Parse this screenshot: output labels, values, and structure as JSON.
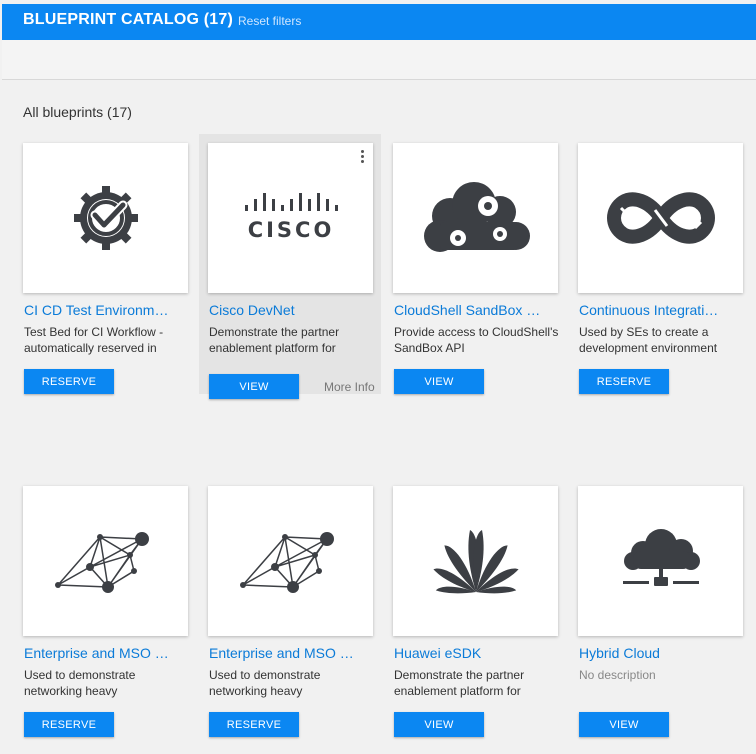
{
  "header": {
    "title": "BLUEPRINT CATALOG (17)",
    "reset_label": "Reset filters"
  },
  "section": {
    "title": "All blueprints (17)"
  },
  "cards": [
    {
      "name": "CI CD Test Environm…",
      "description": "Test Bed for CI Workflow - automatically reserved in",
      "action": "RESERVE",
      "icon": "gear-check-icon"
    },
    {
      "name": "Cisco DevNet",
      "description": "Demonstrate the partner enablement platform for",
      "action": "VIEW",
      "more_info": "More Info",
      "icon": "cisco-logo-icon"
    },
    {
      "name": "CloudShell SandBox …",
      "description": "Provide access to CloudShell's SandBox API",
      "action": "VIEW",
      "icon": "cloud-gears-icon"
    },
    {
      "name": "Continuous Integrati…",
      "description": "Used by SEs to create a development environment",
      "action": "RESERVE",
      "icon": "infinity-arrows-icon"
    },
    {
      "name": "Enterprise and MSO …",
      "description": "Used to demonstrate networking heavy",
      "action": "RESERVE",
      "icon": "network-graph-icon"
    },
    {
      "name": "Enterprise and MSO …",
      "description": "Used to demonstrate networking heavy",
      "action": "RESERVE",
      "icon": "network-graph-icon"
    },
    {
      "name": "Huawei eSDK",
      "description": "Demonstrate the partner enablement platform for",
      "action": "VIEW",
      "icon": "huawei-logo-icon"
    },
    {
      "name": "Hybrid Cloud",
      "description": "No description",
      "action": "VIEW",
      "icon": "cloud-network-icon"
    }
  ],
  "colors": {
    "accent": "#0b87f2",
    "link": "#0b7bd8",
    "icon": "#3c3f44"
  }
}
